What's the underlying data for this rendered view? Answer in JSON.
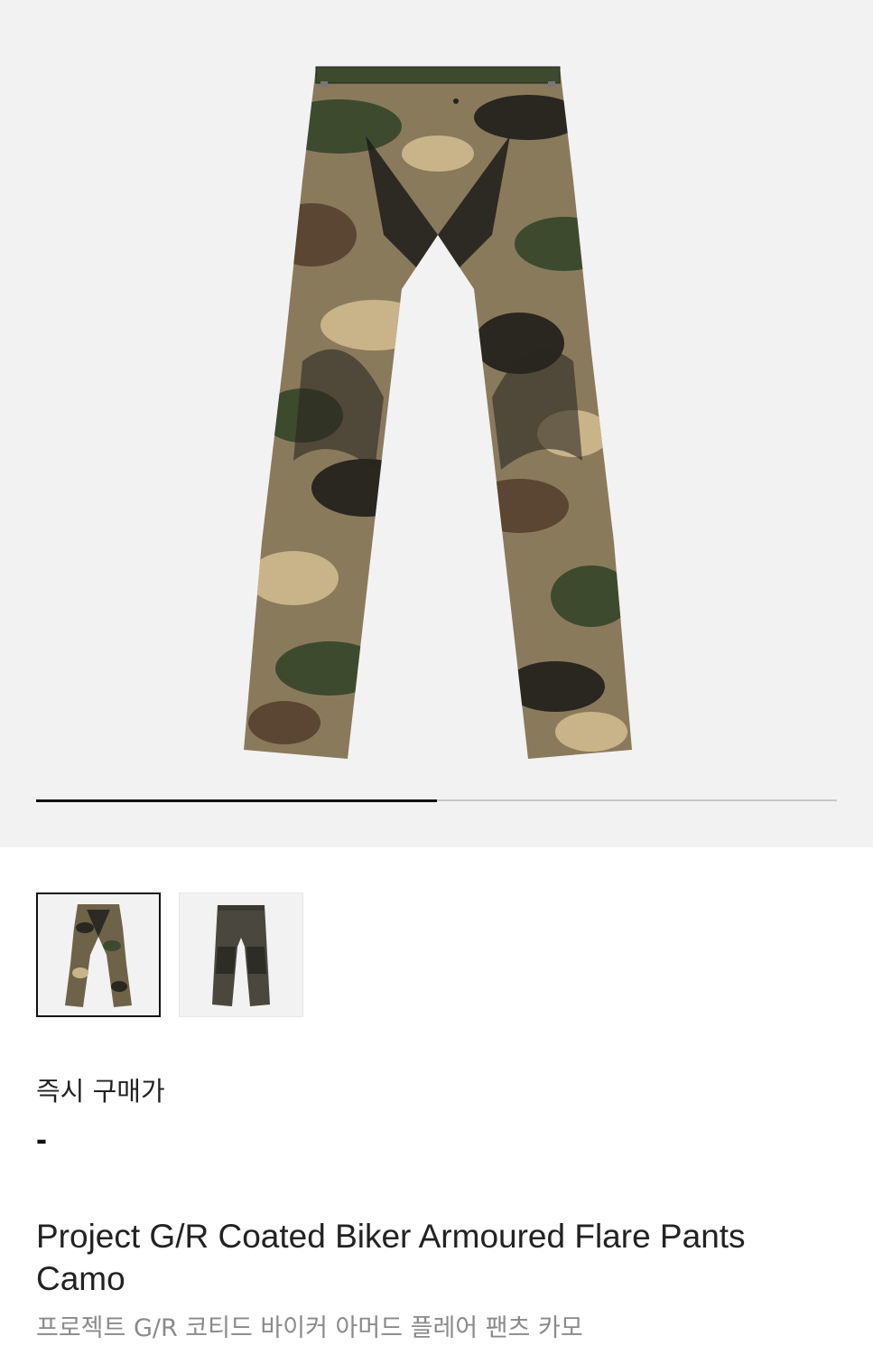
{
  "product": {
    "image_name": "camo-flare-pants-image",
    "gallery": {
      "current_index": 1,
      "total": 2,
      "progress_fraction": 0.5,
      "thumbnails": [
        {
          "name": "thumbnail-camo-pants",
          "selected": true
        },
        {
          "name": "thumbnail-brown-coated-pants",
          "selected": false
        }
      ]
    },
    "price_label": "즉시 구매가",
    "price_value": "-",
    "title_en": "Project G/R Coated Biker Armoured Flare Pants Camo",
    "title_ko": "프로젝트 G/R 코티드 바이커 아머드 플레어 팬츠 카모"
  },
  "colors": {
    "hero_bg": "#f2f2f2",
    "progress_fill": "#111111",
    "progress_track": "#c8c8c8",
    "subtitle": "#8a8a8a"
  }
}
